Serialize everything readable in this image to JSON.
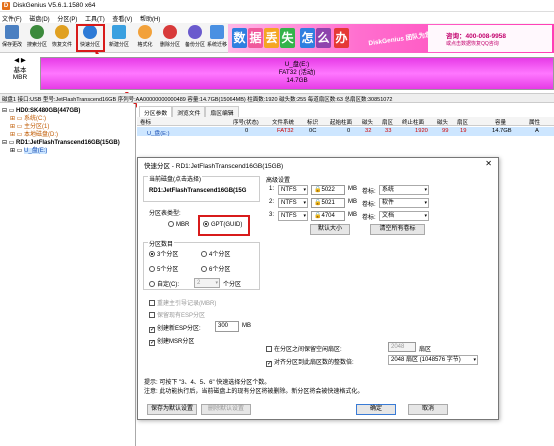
{
  "app": {
    "title": "DiskGenius V5.6.1.1580 x64",
    "icon": "D"
  },
  "menu": [
    "文件(F)",
    "磁盘(D)",
    "分区(P)",
    "工具(T)",
    "查看(V)",
    "帮助(H)"
  ],
  "toolbar": {
    "buttons": [
      {
        "label": "保存更改",
        "color": "#4a7fc1"
      },
      {
        "label": "搜索分区",
        "color": "#3c8a3c"
      },
      {
        "label": "恢复文件",
        "color": "#e0a020"
      },
      {
        "label": "快速分区",
        "color": "#2d7ad6"
      },
      {
        "label": "新建分区",
        "color": "#3aa0e0"
      },
      {
        "label": "格式化",
        "color": "#f2a13a"
      },
      {
        "label": "删除分区",
        "color": "#d83a3a"
      },
      {
        "label": "备份分区",
        "color": "#6a5acd"
      },
      {
        "label": "系统迁移",
        "color": "#4a90e2"
      }
    ],
    "banner": {
      "chars": [
        "数",
        "据",
        "丢",
        "失",
        "怎",
        "么",
        "办"
      ],
      "brand": "DiskGenius 团队为您服务",
      "phone_label": "咨询：400-008-9958",
      "phone_sub": "或点击数据恢复QQ咨询"
    }
  },
  "diskbar": {
    "nav_left": "◀",
    "nav_right": "▶",
    "basic": "基本",
    "mbr": "MBR",
    "line1": "U_盘(E:)",
    "line2": "FAT32 (活动)",
    "line3": "14.7GB"
  },
  "infoline": "磁盘1 接口:USB 型号:JetFlashTranscend16GB 序列号:AA00000000000489 容量:14.7GB(15064MB) 柱面数:1920 磁头数:255 每道扇区数:63 总扇区数:30851072",
  "tree": [
    "HD0:SK480GB(447GB)",
    "系统(C:)",
    "主分区(1)",
    "本地磁盘(D:)",
    "RD1:JetFlashTranscend16GB(15GB)",
    "U_盘(E:)"
  ],
  "right_panel": {
    "tabs": [
      "分区参数",
      "浏览文件",
      "扇区编辑"
    ],
    "headers": [
      "卷标",
      "序号(状态)",
      "文件系统",
      "标识",
      "起始柱面",
      "磁头",
      "扇区",
      "终止柱面",
      "磁头",
      "扇区",
      "容量",
      "属性"
    ],
    "row": [
      "U_盘(E:)",
      "0",
      "FAT32",
      "0C",
      "0",
      "32",
      "33",
      "1920",
      "99",
      "19",
      "14.7GB",
      "A"
    ]
  },
  "dialog": {
    "title": "快速分区 - RD1:JetFlashTranscend16GB(15GB)",
    "close": "✕",
    "current_disk_label": "当前磁盘(点击选择)",
    "current_disk_value": "RD1:JetFlashTranscend16GB(15G",
    "partition_type_label": "分区表类型:",
    "pt_mbr": "MBR",
    "pt_gpt": "GPT(GUID)",
    "partition_count_label": "分区数目",
    "counts": [
      "3个分区",
      "4个分区",
      "5个分区",
      "6个分区"
    ],
    "custom_label": "自定(C):",
    "custom_value": "2",
    "custom_unit": "个分区",
    "opt_rebuild_mbr": "重建主引导记录(MBR)",
    "opt_keep_esp": "保留现有ESP分区",
    "opt_create_esp": "创建新ESP分区:",
    "esp_size": "300",
    "esp_unit": "MB",
    "opt_create_msr": "创建MSR分区",
    "advanced_label": "高级设置",
    "adv_rows": [
      {
        "idx": "1:",
        "fs": "NTFS",
        "size": "5022",
        "unit": "MB",
        "vol_label": "卷标:",
        "vol": "系统"
      },
      {
        "idx": "2:",
        "fs": "NTFS",
        "size": "5021",
        "unit": "MB",
        "vol_label": "卷标:",
        "vol": "软件"
      },
      {
        "idx": "3:",
        "fs": "NTFS",
        "size": "4704",
        "unit": "MB",
        "vol_label": "卷标:",
        "vol": "文档"
      }
    ],
    "default_size": "默认大小",
    "clear_labels": "清空所有卷标",
    "reserve_label": "在分区之间保留空闲扇区:",
    "reserve_value": "2048",
    "reserve_unit": "扇区",
    "align_label": "对齐分区到此扇区数的整数倍:",
    "align_value": "2048 扇区 (1048576 字节)",
    "tip1": "提示: 可按下 \"3、4、5、6\" 快速选择分区个数。",
    "tip2": "注意: 此功能执行后，当前磁盘上的现有分区将被删除。新分区将会被快速格式化。",
    "save_default": "保存为默认设置",
    "delete_default": "删除默认设置",
    "ok": "确定",
    "cancel": "取消"
  },
  "colors": {
    "accent_red": "#d81b1b",
    "disk_pink": "#ff77ff",
    "selected_row": "#cde6ff"
  }
}
